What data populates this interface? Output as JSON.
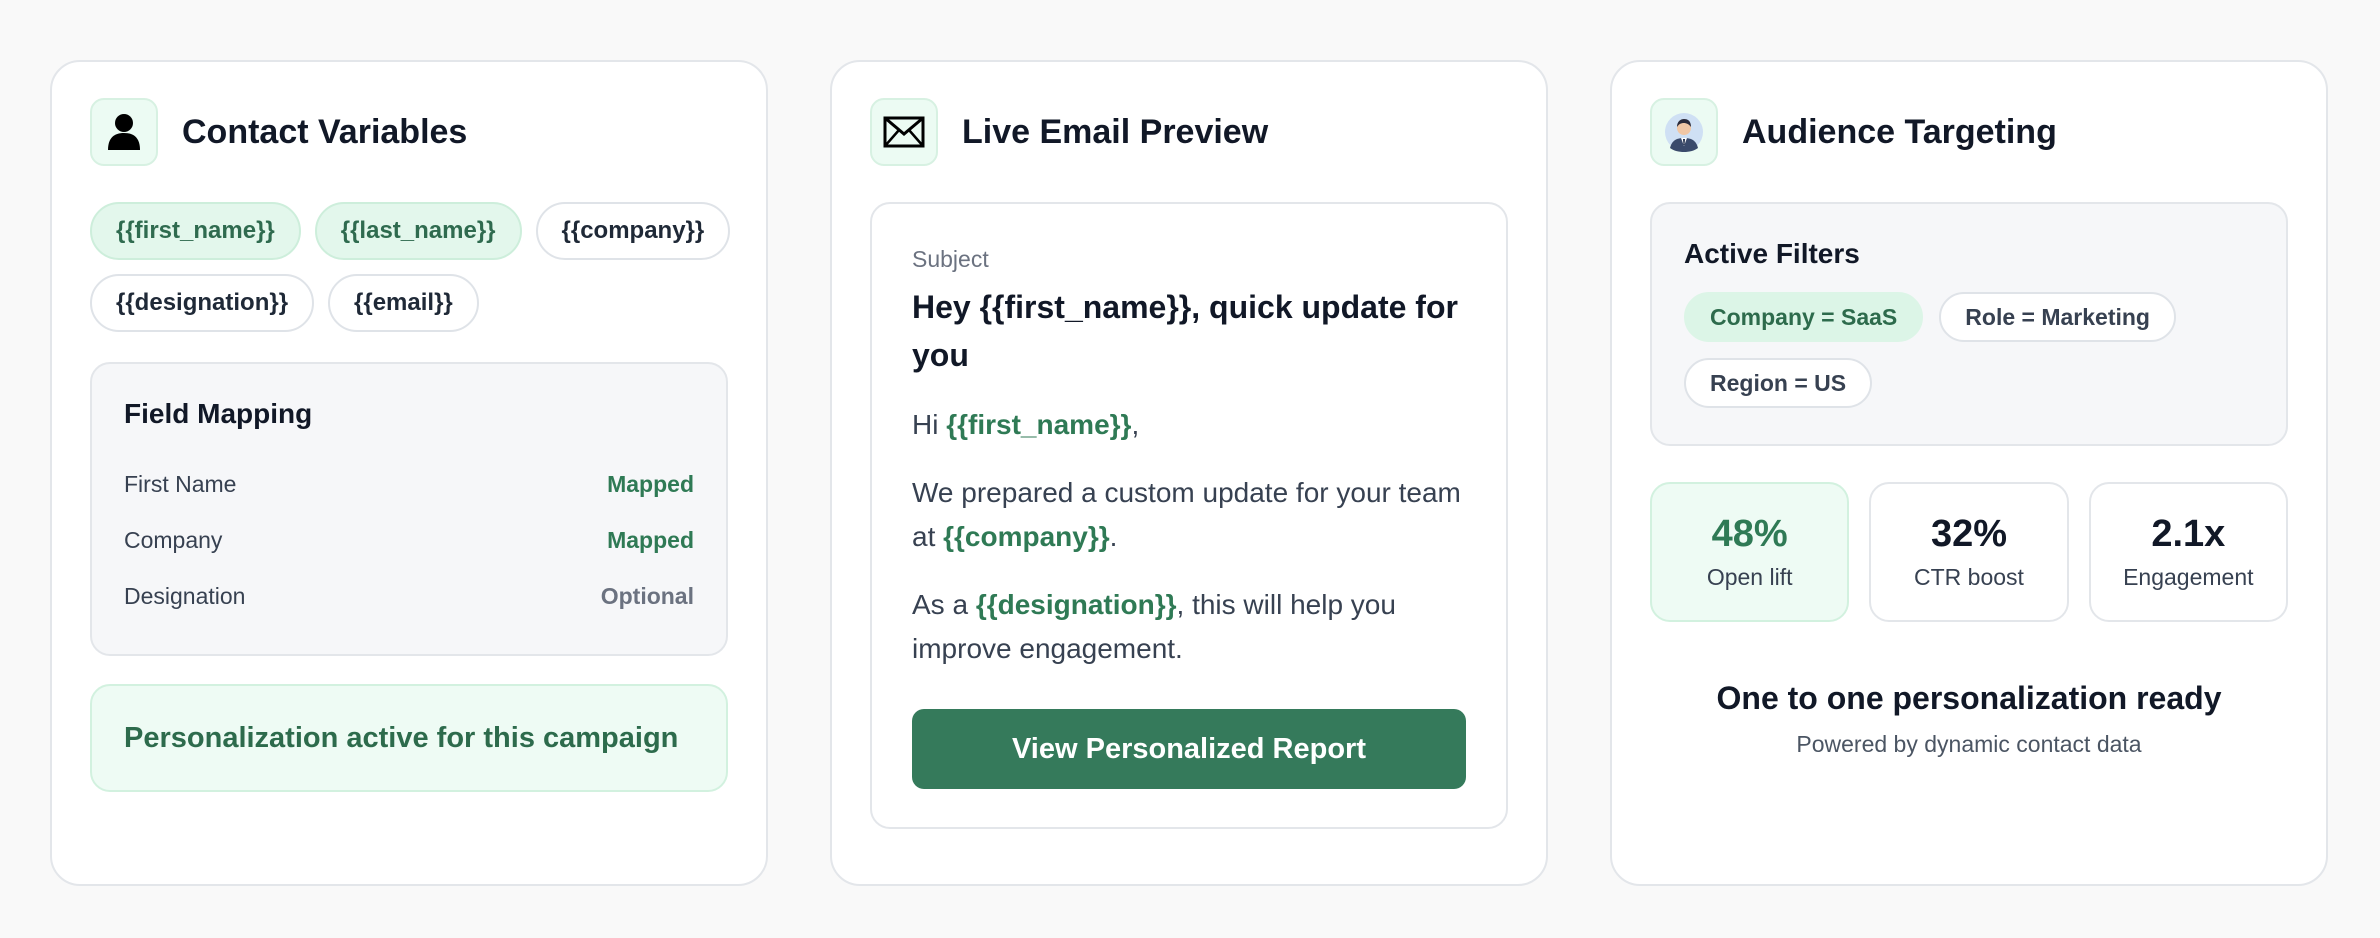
{
  "contact_card": {
    "title": "Contact Variables",
    "icon": "user-icon",
    "variables": [
      {
        "label": "{{first_name}}",
        "highlighted": true
      },
      {
        "label": "{{last_name}}",
        "highlighted": true
      },
      {
        "label": "{{company}}",
        "highlighted": false
      },
      {
        "label": "{{designation}}",
        "highlighted": false
      },
      {
        "label": "{{email}}",
        "highlighted": false
      }
    ],
    "field_mapping": {
      "title": "Field Mapping",
      "rows": [
        {
          "label": "First Name",
          "status": "Mapped"
        },
        {
          "label": "Company",
          "status": "Mapped"
        },
        {
          "label": "Designation",
          "status": "Optional"
        }
      ]
    },
    "banner": "Personalization active for this campaign"
  },
  "email_card": {
    "title": "Live Email Preview",
    "icon": "envelope-icon",
    "subject_label": "Subject",
    "subject": "Hey {{first_name}}, quick update for you",
    "greeting_prefix": "Hi ",
    "greeting_var": "{{first_name}}",
    "greeting_suffix": ",",
    "p1_prefix": "We prepared a custom update for your team at ",
    "p1_var": "{{company}}",
    "p1_suffix": ".",
    "p2_prefix": "As a ",
    "p2_var": "{{designation}}",
    "p2_suffix": ", this will help you improve engagement.",
    "cta": "View Personalized Report"
  },
  "audience_card": {
    "title": "Audience Targeting",
    "icon": "person-avatar-icon",
    "filters_title": "Active Filters",
    "filters": [
      {
        "label": "Company = SaaS",
        "highlighted": true
      },
      {
        "label": "Role = Marketing",
        "highlighted": false
      },
      {
        "label": "Region = US",
        "highlighted": false
      }
    ],
    "stats": [
      {
        "value": "48%",
        "label": "Open lift",
        "highlighted": true
      },
      {
        "value": "32%",
        "label": "CTR boost",
        "highlighted": false
      },
      {
        "value": "2.1x",
        "label": "Engagement",
        "highlighted": false
      }
    ],
    "ready_title": "One to one personalization ready",
    "ready_subtitle": "Powered by dynamic contact data"
  },
  "colors": {
    "accent_green": "#357a5b",
    "light_green": "#eefbf4",
    "text_dark": "#111827"
  }
}
